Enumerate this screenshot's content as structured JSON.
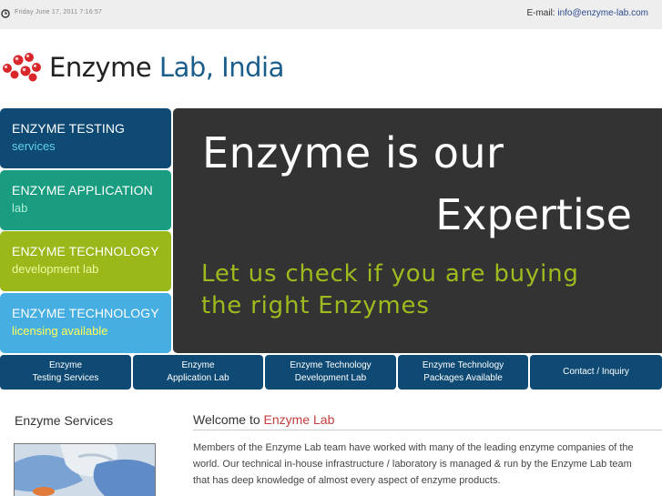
{
  "topbar": {
    "date": "Friday June 17, 2011 7:16:57",
    "email_label": "E-mail:",
    "email": "info@enzyme-lab.com"
  },
  "logo": {
    "word1": "Enzyme ",
    "word2": "Lab, India"
  },
  "sidebar": {
    "items": [
      {
        "line1": "ENZYME TESTING",
        "line2": "services"
      },
      {
        "line1": "ENZYME APPLICATION",
        "line2": "lab"
      },
      {
        "line1": "ENZYME TECHNOLOGY",
        "line2": "development lab"
      },
      {
        "line1": "ENZYME TECHNOLOGY",
        "line2": "licensing available"
      }
    ]
  },
  "hero": {
    "line1": "Enzyme is our",
    "line2": "Expertise",
    "tag1": "Let us check if you are buying",
    "tag2": "the right Enzymes"
  },
  "nav": [
    {
      "line1": "Enzyme",
      "line2": "Testing Services"
    },
    {
      "line1": "Enzyme",
      "line2": "Application Lab"
    },
    {
      "line1": "Enzyme Technology",
      "line2": "Development Lab"
    },
    {
      "line1": "Enzyme Technology",
      "line2": "Packages Available"
    },
    {
      "line1": "Contact / Inquiry",
      "line2": ""
    }
  ],
  "services": {
    "title": "Enzyme Services"
  },
  "welcome": {
    "prefix": "Welcome to ",
    "accent": "Enzyme Lab",
    "text": "Members of the Enzyme Lab team have worked with many of the leading enzyme companies of the world. Our technical in-house infrastructure / laboratory is managed & run by the Enzyme Lab team that has deep knowledge of almost every aspect of enzyme products."
  },
  "colors": {
    "navy": "#0e4a73",
    "teal": "#1a9c80",
    "lime": "#9ab81a",
    "sky": "#46aee0",
    "hero_bg": "#333333",
    "accent_red": "#c43c3c"
  }
}
